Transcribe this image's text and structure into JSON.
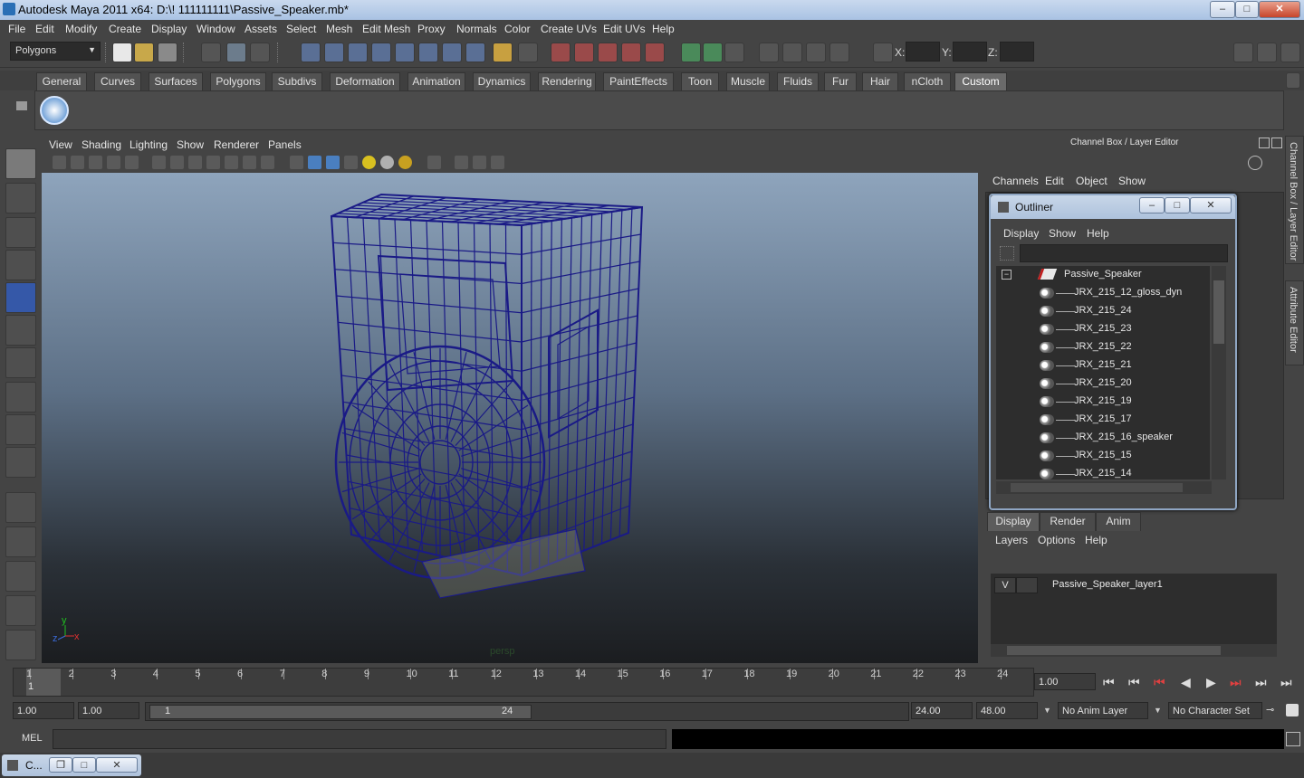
{
  "window": {
    "title": "Autodesk Maya 2011 x64: D:\\! 111111111\\Passive_Speaker.mb*",
    "minimize": "–",
    "maximize": "□",
    "close": "✕"
  },
  "menubar": [
    "File",
    "Edit",
    "Modify",
    "Create",
    "Display",
    "Window",
    "Assets",
    "Select",
    "Mesh",
    "Edit Mesh",
    "Proxy",
    "Normals",
    "Color",
    "Create UVs",
    "Edit UVs",
    "Help"
  ],
  "statusline": {
    "mode": "Polygons",
    "x_label": "X:",
    "y_label": "Y:",
    "z_label": "Z:"
  },
  "shelf_tabs": [
    "General",
    "Curves",
    "Surfaces",
    "Polygons",
    "Subdivs",
    "Deformation",
    "Animation",
    "Dynamics",
    "Rendering",
    "PaintEffects",
    "Toon",
    "Muscle",
    "Fluids",
    "Fur",
    "Hair",
    "nCloth",
    "Custom"
  ],
  "shelf_active_tab": "Custom",
  "viewport": {
    "menu": [
      "View",
      "Shading",
      "Lighting",
      "Show",
      "Renderer",
      "Panels"
    ],
    "camera_label": "persp",
    "axis_y": "y",
    "axis_x": "x",
    "axis_z": "z",
    "wire_color": "#1a1a86"
  },
  "channel_box": {
    "header": "Channel Box / Layer Editor",
    "menu": [
      "Channels",
      "Edit",
      "Object",
      "Show"
    ]
  },
  "outliner": {
    "title": "Outliner",
    "menu": [
      "Display",
      "Show",
      "Help"
    ],
    "root": "Passive_Speaker",
    "collapse_symbol": "−",
    "items": [
      "JRX_215_12_gloss_dyn",
      "JRX_215_24",
      "JRX_215_23",
      "JRX_215_22",
      "JRX_215_21",
      "JRX_215_20",
      "JRX_215_19",
      "JRX_215_17",
      "JRX_215_16_speaker",
      "JRX_215_15",
      "JRX_215_14"
    ],
    "win_min": "–",
    "win_max": "□",
    "win_close": "✕"
  },
  "layer_editor": {
    "tabs": [
      "Display",
      "Render",
      "Anim"
    ],
    "active_tab": "Display",
    "menu": [
      "Layers",
      "Options",
      "Help"
    ],
    "layer": {
      "visible": "V",
      "name": "Passive_Speaker_layer1"
    }
  },
  "side_tabs": [
    "Channel Box / Layer Editor",
    "Attribute Editor"
  ],
  "time_slider": {
    "ticks": [
      "1",
      "2",
      "3",
      "4",
      "5",
      "6",
      "7",
      "8",
      "9",
      "10",
      "11",
      "12",
      "13",
      "14",
      "15",
      "16",
      "17",
      "18",
      "19",
      "20",
      "21",
      "22",
      "23",
      "24"
    ],
    "current_marker": "1",
    "current_time": "1.00"
  },
  "range": {
    "start": "1.00",
    "playback_start": "1.00",
    "slider_start": "1",
    "slider_end": "24",
    "playback_end": "24.00",
    "end": "48.00",
    "anim_layer": "No Anim Layer",
    "character_set": "No Character Set"
  },
  "command_line": {
    "label": "MEL"
  },
  "taskbar": {
    "item": "C..."
  }
}
